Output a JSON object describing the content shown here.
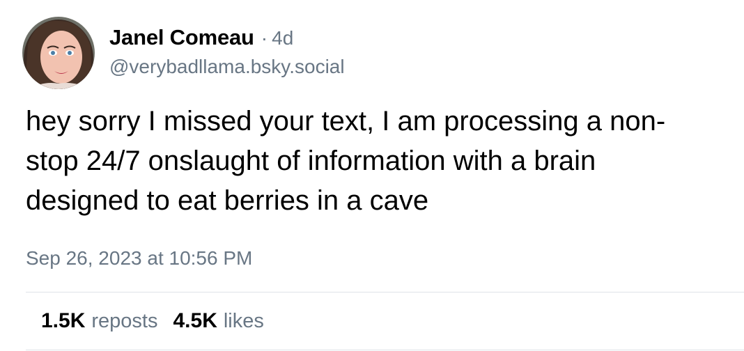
{
  "author": {
    "display_name": "Janel Comeau",
    "separator": "·",
    "age": "4d",
    "handle": "@verybadllama.bsky.social"
  },
  "post": {
    "text": "hey sorry I missed your text, I am processing a non-\nstop 24/7 onslaught of information with a brain\ndesigned to eat berries in a cave",
    "timestamp": "Sep 26, 2023 at 10:56 PM"
  },
  "stats": {
    "reposts_count": "1.5K",
    "reposts_label": "reposts",
    "likes_count": "4.5K",
    "likes_label": "likes"
  },
  "colors": {
    "text": "#000000",
    "secondary_text": "#687684",
    "divider": "#dfe3e8"
  }
}
